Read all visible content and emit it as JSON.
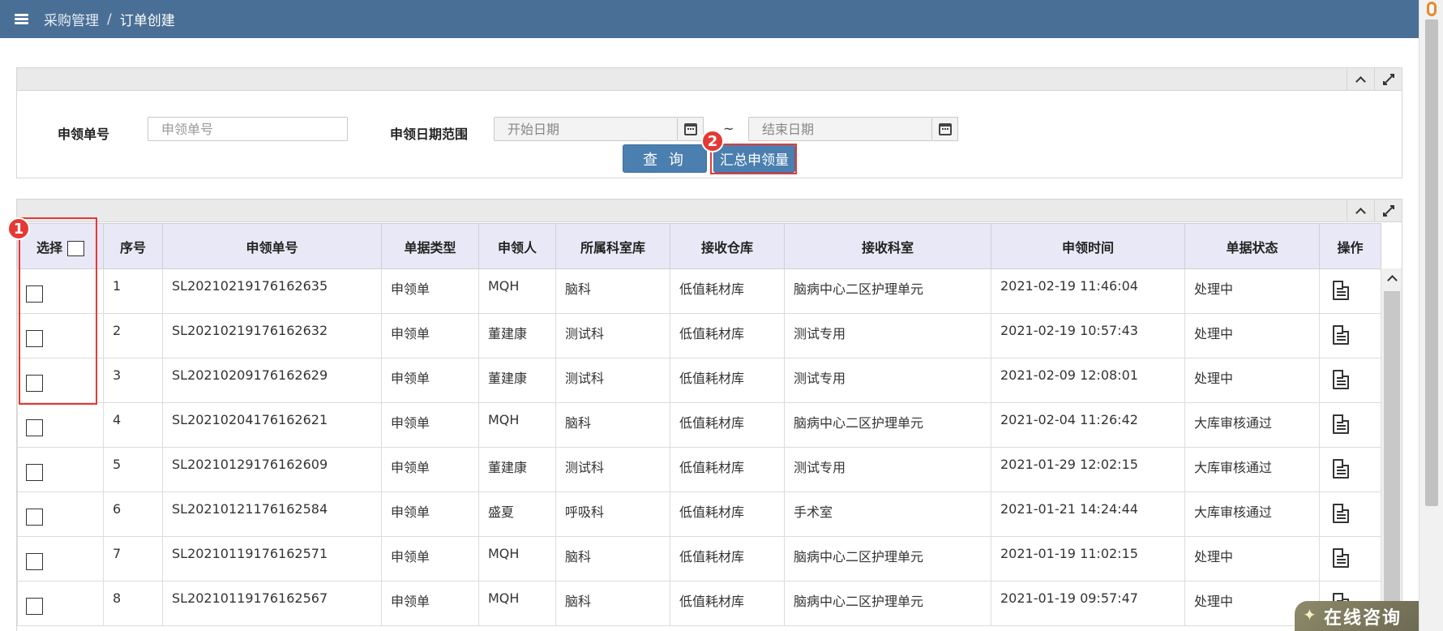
{
  "breadcrumb": {
    "items": [
      "采购管理",
      "订单创建"
    ],
    "separator": "/"
  },
  "search": {
    "order_no_label": "申领单号",
    "order_no_placeholder": "申领单号",
    "date_range_label": "申领日期范围",
    "start_placeholder": "开始日期",
    "end_placeholder": "结束日期",
    "tilde": "~",
    "query_label": "查 询",
    "summary_label": "汇总申领量"
  },
  "table": {
    "select_label": "选择",
    "headers": [
      "序号",
      "申领单号",
      "单据类型",
      "申领人",
      "所属科室库",
      "接收仓库",
      "接收科室",
      "申领时间",
      "单据状态",
      "操作"
    ],
    "rows": [
      {
        "no": "1",
        "order": "SL20210219176162635",
        "type": "申领单",
        "person": "MQH",
        "dept": "脑科",
        "warehouse": "低值耗材库",
        "recv": "脑病中心二区护理单元",
        "time": "2021-02-19 11:46:04",
        "status": "处理中"
      },
      {
        "no": "2",
        "order": "SL20210219176162632",
        "type": "申领单",
        "person": "董建康",
        "dept": "测试科",
        "warehouse": "低值耗材库",
        "recv": "测试专用",
        "time": "2021-02-19 10:57:43",
        "status": "处理中"
      },
      {
        "no": "3",
        "order": "SL20210209176162629",
        "type": "申领单",
        "person": "董建康",
        "dept": "测试科",
        "warehouse": "低值耗材库",
        "recv": "测试专用",
        "time": "2021-02-09 12:08:01",
        "status": "处理中"
      },
      {
        "no": "4",
        "order": "SL20210204176162621",
        "type": "申领单",
        "person": "MQH",
        "dept": "脑科",
        "warehouse": "低值耗材库",
        "recv": "脑病中心二区护理单元",
        "time": "2021-02-04 11:26:42",
        "status": "大库审核通过"
      },
      {
        "no": "5",
        "order": "SL20210129176162609",
        "type": "申领单",
        "person": "董建康",
        "dept": "测试科",
        "warehouse": "低值耗材库",
        "recv": "测试专用",
        "time": "2021-01-29 12:02:15",
        "status": "大库审核通过"
      },
      {
        "no": "6",
        "order": "SL20210121176162584",
        "type": "申领单",
        "person": "盛夏",
        "dept": "呼吸科",
        "warehouse": "低值耗材库",
        "recv": "手术室",
        "time": "2021-01-21 14:24:44",
        "status": "大库审核通过"
      },
      {
        "no": "7",
        "order": "SL20210119176162571",
        "type": "申领单",
        "person": "MQH",
        "dept": "脑科",
        "warehouse": "低值耗材库",
        "recv": "脑病中心二区护理单元",
        "time": "2021-01-19 11:02:15",
        "status": "处理中"
      },
      {
        "no": "8",
        "order": "SL20210119176162567",
        "type": "申领单",
        "person": "MQH",
        "dept": "脑科",
        "warehouse": "低值耗材库",
        "recv": "脑病中心二区护理单元",
        "time": "2021-01-19 09:57:47",
        "status": "处理中"
      }
    ]
  },
  "annotations": {
    "marker1": "1",
    "marker2": "2"
  },
  "consult": {
    "label": "在线咨询"
  },
  "colors": {
    "topbar": "#4a6f96",
    "accent": "#4a7fb0",
    "annotation": "#e53935",
    "header_bg": "#e8e8f6"
  }
}
